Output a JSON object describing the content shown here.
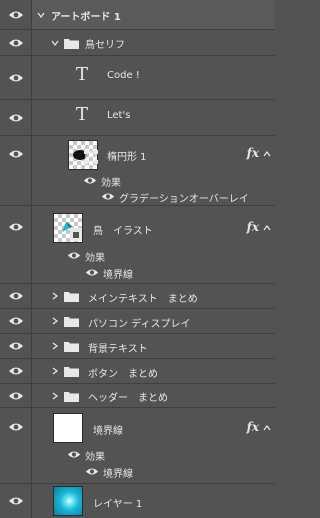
{
  "layers": {
    "artboard": {
      "label": "アートボード 1"
    },
    "group_tori_serif": {
      "label": "鳥セリフ"
    },
    "text_code": {
      "label": "Code !"
    },
    "text_lets": {
      "label": "Let's"
    },
    "ellipse": {
      "label": "楕円形 1",
      "effects_label": "効果",
      "effect_item": "グラデーションオーバーレイ",
      "fx": "fx"
    },
    "tori_illust": {
      "label": "鳥　イラスト",
      "effects_label": "効果",
      "effect_item": "境界線",
      "fx": "fx"
    },
    "group_main_text": {
      "label": "メインテキスト　まとめ"
    },
    "group_pc_display": {
      "label": "パソコン ディスプレイ"
    },
    "group_bg_text": {
      "label": "背景テキスト"
    },
    "group_buttons": {
      "label": "ボタン　まとめ"
    },
    "group_header": {
      "label": "ヘッダー　まとめ"
    },
    "border_layer": {
      "label": "境界線",
      "effects_label": "効果",
      "effect_item": "境界線",
      "fx": "fx"
    },
    "layer1": {
      "label": "レイヤー 1"
    }
  },
  "colors": {
    "panel_bg": "#535353",
    "selected_bg": "#5e5e5e",
    "divider": "#3f3f3f",
    "text": "#e8e8e8",
    "thumb_cyan": "#1ab6d4"
  }
}
